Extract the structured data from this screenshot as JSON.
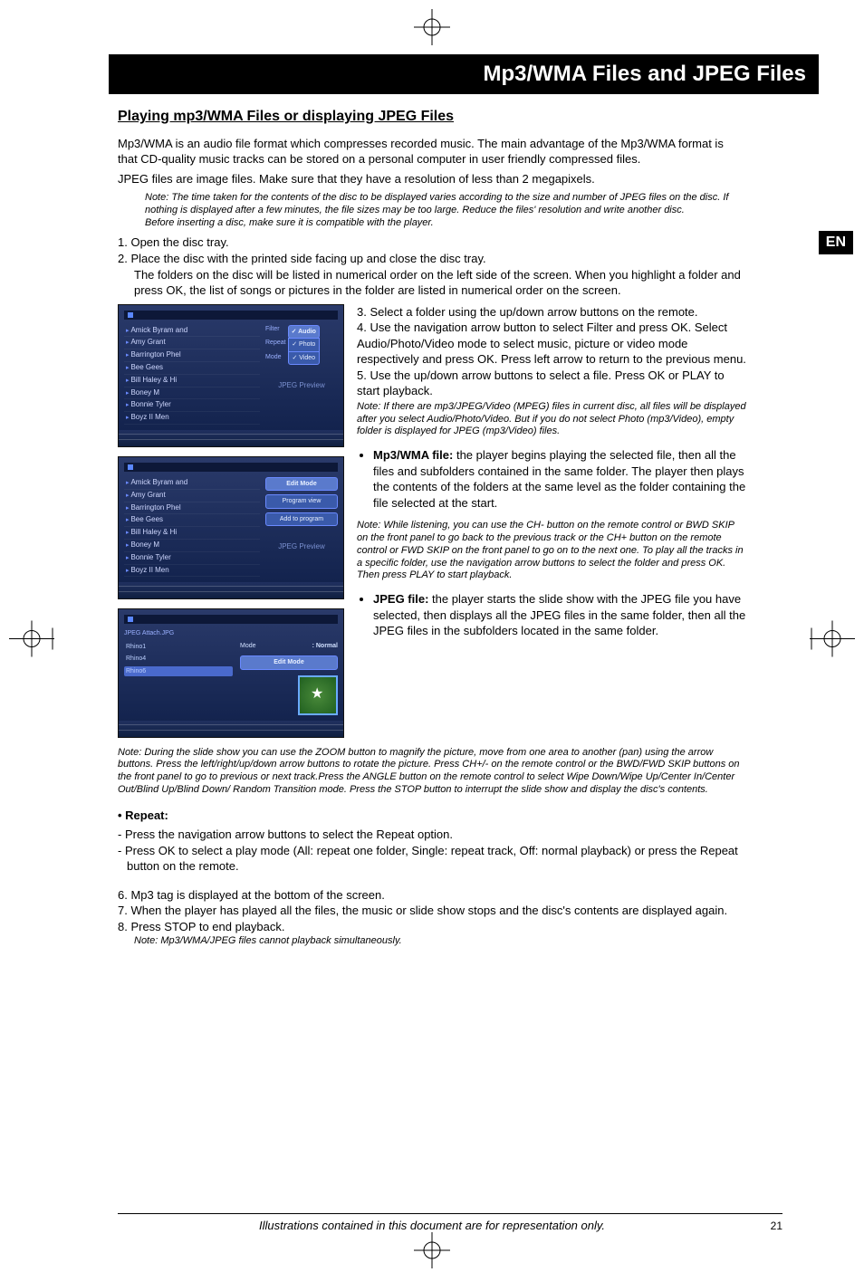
{
  "title": "Mp3/WMA Files and JPEG Files",
  "lang_badge": "EN",
  "subheading": "Playing mp3/WMA Files or displaying JPEG Files",
  "intro_p1": "Mp3/WMA is an audio file format which compresses recorded music. The main advantage of the Mp3/WMA format is that CD-quality music tracks can be stored on a personal computer in user friendly compressed files.",
  "intro_p2": "JPEG files are image files. Make sure that they have a resolution of less than 2 megapixels.",
  "note_top": "Note: The time taken for the contents of the disc to be displayed varies according to the size and number of JPEG files on the disc. If nothing is displayed after a few minutes, the file sizes may be too large. Reduce the files' resolution and write another disc.\nBefore inserting a disc, make sure it is compatible with the player.",
  "steps12": {
    "s1": "1. Open the disc tray.",
    "s2": "2. Place the disc with the printed side facing up and close the disc tray.",
    "s2b": "The folders on the disc will be listed in numerical order on the left side of the screen. When you highlight a folder and press OK, the list of songs or pictures in the folder are listed in numerical order on the screen."
  },
  "steps345": {
    "s3": "3. Select a folder using the up/down arrow buttons on the remote.",
    "s4": "4.  Use the navigation arrow button to select Filter and press OK. Select Audio/Photo/Video mode to select music, picture or video mode respectively and press OK. Press left arrow to return to the previous menu.",
    "s5": "5.  Use the up/down arrow buttons to select a file. Press OK or PLAY to start playback."
  },
  "note_after5": "Note: If there are mp3/JPEG/Video (MPEG) files in current disc, all files will be displayed after you select Audio/Photo/Video. But if you do not select Photo (mp3/Video), empty folder is displayed for JPEG (mp3/Video) files.",
  "bullet_mp3_label": "Mp3/WMA file:",
  "bullet_mp3_text": " the player begins playing the selected file, then all the files and subfolders contained in the same folder. The player then plays the contents of the folders at the same level as the folder containing the file selected at the start.",
  "note_while": "Note: While listening, you can use the CH- button on the remote control or BWD SKIP on the front panel to go back to the previous track or the CH+ button on the remote control or FWD SKIP on the front panel to go on to the next one. To play all the tracks in a specific folder, use the navigation arrow buttons to select the folder and press OK. Then press PLAY to start playback.",
  "bullet_jpeg_label": "JPEG file:",
  "bullet_jpeg_text": " the player starts the slide show with the JPEG file you have selected, then displays all the JPEG files in the same folder, then all the JPEG files in the subfolders located in the same folder.",
  "note_slide": "Note: During the slide show you can use the ZOOM button to magnify the picture, move from one area to another (pan) using the arrow buttons. Press the left/right/up/down arrow buttons to rotate the picture. Press CH+/- on the remote control or the BWD/FWD SKIP buttons on the front panel to go to previous or next track.Press the ANGLE button on the remote control to select Wipe Down/Wipe Up/Center In/Center Out/Blind Up/Blind Down/ Random Transition mode. Press the STOP button to interrupt the slide show and display the disc's contents.",
  "repeat_label": "• Repeat:",
  "repeat_l1": "- Press the navigation arrow buttons to select the Repeat option.",
  "repeat_l2": "- Press OK to select a play mode (All: repeat one folder, Single: repeat track, Off: normal playback) or press  the Repeat button on the remote.",
  "steps678": {
    "s6": "6. Mp3 tag is displayed at the bottom of the screen.",
    "s7": "7. When the player has played all the files, the music or slide show stops and the disc's contents are displayed again.",
    "s8": "8. Press STOP to end playback.",
    "s8note": "Note: Mp3/WMA/JPEG files cannot playback simultaneously."
  },
  "thumbs": {
    "list": [
      "Amick Byram and",
      "Amy Grant",
      "Barrington Phel",
      "Bee Gees",
      "Bill Haley & Hi",
      "Boney M",
      "Bonnie Tyler",
      "Boyz II Men"
    ],
    "filter_label": "Filter",
    "filter_opts": {
      "audio": "✓ Audio",
      "photo": "✓ Photo",
      "video": "✓ Video"
    },
    "repeat_label": "Repeat",
    "mode_label": "Mode",
    "jpeg_preview": "JPEG Preview",
    "btn_edit": "Edit Mode",
    "btn_prog": "Program view",
    "btn_add": "Add to program",
    "t3_header": "JPEG Attach.JPG",
    "t3_items": [
      "Rhino1",
      "Rhino4",
      "Rhino6"
    ],
    "t3_mode": "Mode",
    "t3_normal": ": Normal",
    "t3_edit": "Edit Mode"
  },
  "footer": "Illustrations contained in this document are for representation only.",
  "page_num": "21"
}
